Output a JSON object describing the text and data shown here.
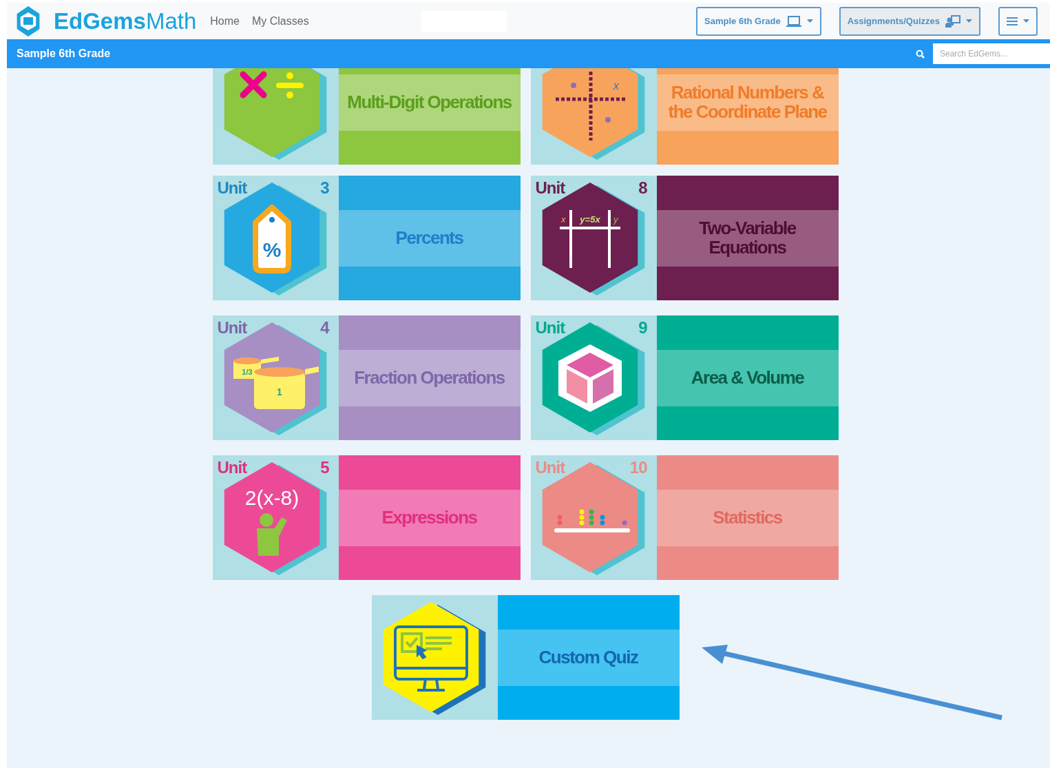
{
  "header": {
    "brand_bold": "EdGems",
    "brand_light": "Math",
    "nav": [
      "Home",
      "My Classes"
    ],
    "buttons": [
      {
        "label": "Sample 6th Grade",
        "kind": "class",
        "selected": false
      },
      {
        "label": "Assignments/Quizzes",
        "kind": "assign",
        "selected": true
      },
      {
        "kind": "menu",
        "selected": false
      }
    ]
  },
  "class_bar": {
    "title": "Sample 6th Grade",
    "search": {
      "placeholder": "Search EdGems..."
    }
  },
  "partial_row": [
    {
      "title": "Multi-Digit Operations"
    },
    {
      "title": "Rational Numbers & the Coordinate Plane",
      "icon_labels": [
        "x"
      ]
    }
  ],
  "rows": [
    [
      {
        "unit": "Unit",
        "number": "3",
        "title": "Percents",
        "icon_labels": [
          "%"
        ]
      },
      {
        "unit": "Unit",
        "number": "8",
        "title": "Two-Variable Equations",
        "icon_labels": [
          "x",
          "y=5x",
          "y"
        ]
      }
    ],
    [
      {
        "unit": "Unit",
        "number": "4",
        "title": "Fraction Operations",
        "icon_labels": [
          "1/3",
          "1"
        ]
      },
      {
        "unit": "Unit",
        "number": "9",
        "title": "Area & Volume"
      }
    ],
    [
      {
        "unit": "Unit",
        "number": "5",
        "title": "Expressions",
        "icon_labels": [
          "2(x-8)"
        ]
      },
      {
        "unit": "Unit",
        "number": "10",
        "title": "Statistics"
      }
    ]
  ],
  "custom": {
    "title": "Custom Quiz"
  }
}
